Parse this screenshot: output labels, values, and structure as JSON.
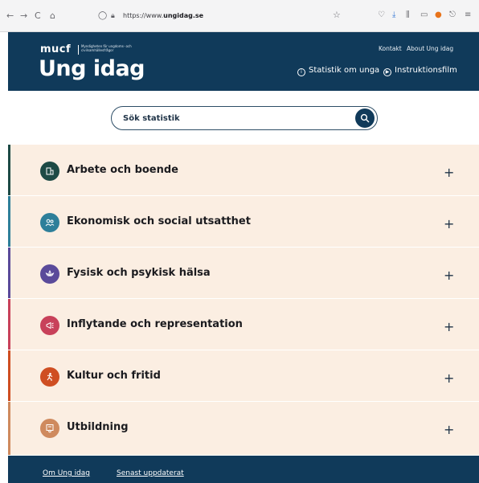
{
  "browser": {
    "url_prefix": "https://www.",
    "url_domain": "ungidag.se",
    "back_glyph": "←",
    "forward_glyph": "→",
    "reload_glyph": "C",
    "home_glyph": "⌂"
  },
  "header": {
    "brand_short": "mucf",
    "brand_sub": "Myndigheten för ungdoms- och civilsamhällesfrågor",
    "site_title": "Ung idag",
    "top_links": [
      "Kontakt",
      "About Ung idag"
    ],
    "main_links": [
      {
        "label": "Statistik om unga",
        "icon": "info-icon"
      },
      {
        "label": "Instruktionsfilm",
        "icon": "play-icon"
      }
    ]
  },
  "search": {
    "placeholder": "Sök statistik"
  },
  "categories": [
    {
      "label": "Arbete och boende",
      "icon": "building-icon",
      "color": "#1d4a45"
    },
    {
      "label": "Ekonomisk och social utsatthet",
      "icon": "people-icon",
      "color": "#2e7f9a"
    },
    {
      "label": "Fysisk och psykisk hälsa",
      "icon": "lotus-icon",
      "color": "#5a4a9a"
    },
    {
      "label": "Inflytande och representation",
      "icon": "megaphone-icon",
      "color": "#c8415a"
    },
    {
      "label": "Kultur och fritid",
      "icon": "dancer-icon",
      "color": "#cf4e22"
    },
    {
      "label": "Utbildning",
      "icon": "diploma-icon",
      "color": "#cf8a5e"
    }
  ],
  "expand_glyph": "+",
  "footer": {
    "links": [
      "Om Ung idag",
      "Senast uppdaterat"
    ]
  }
}
